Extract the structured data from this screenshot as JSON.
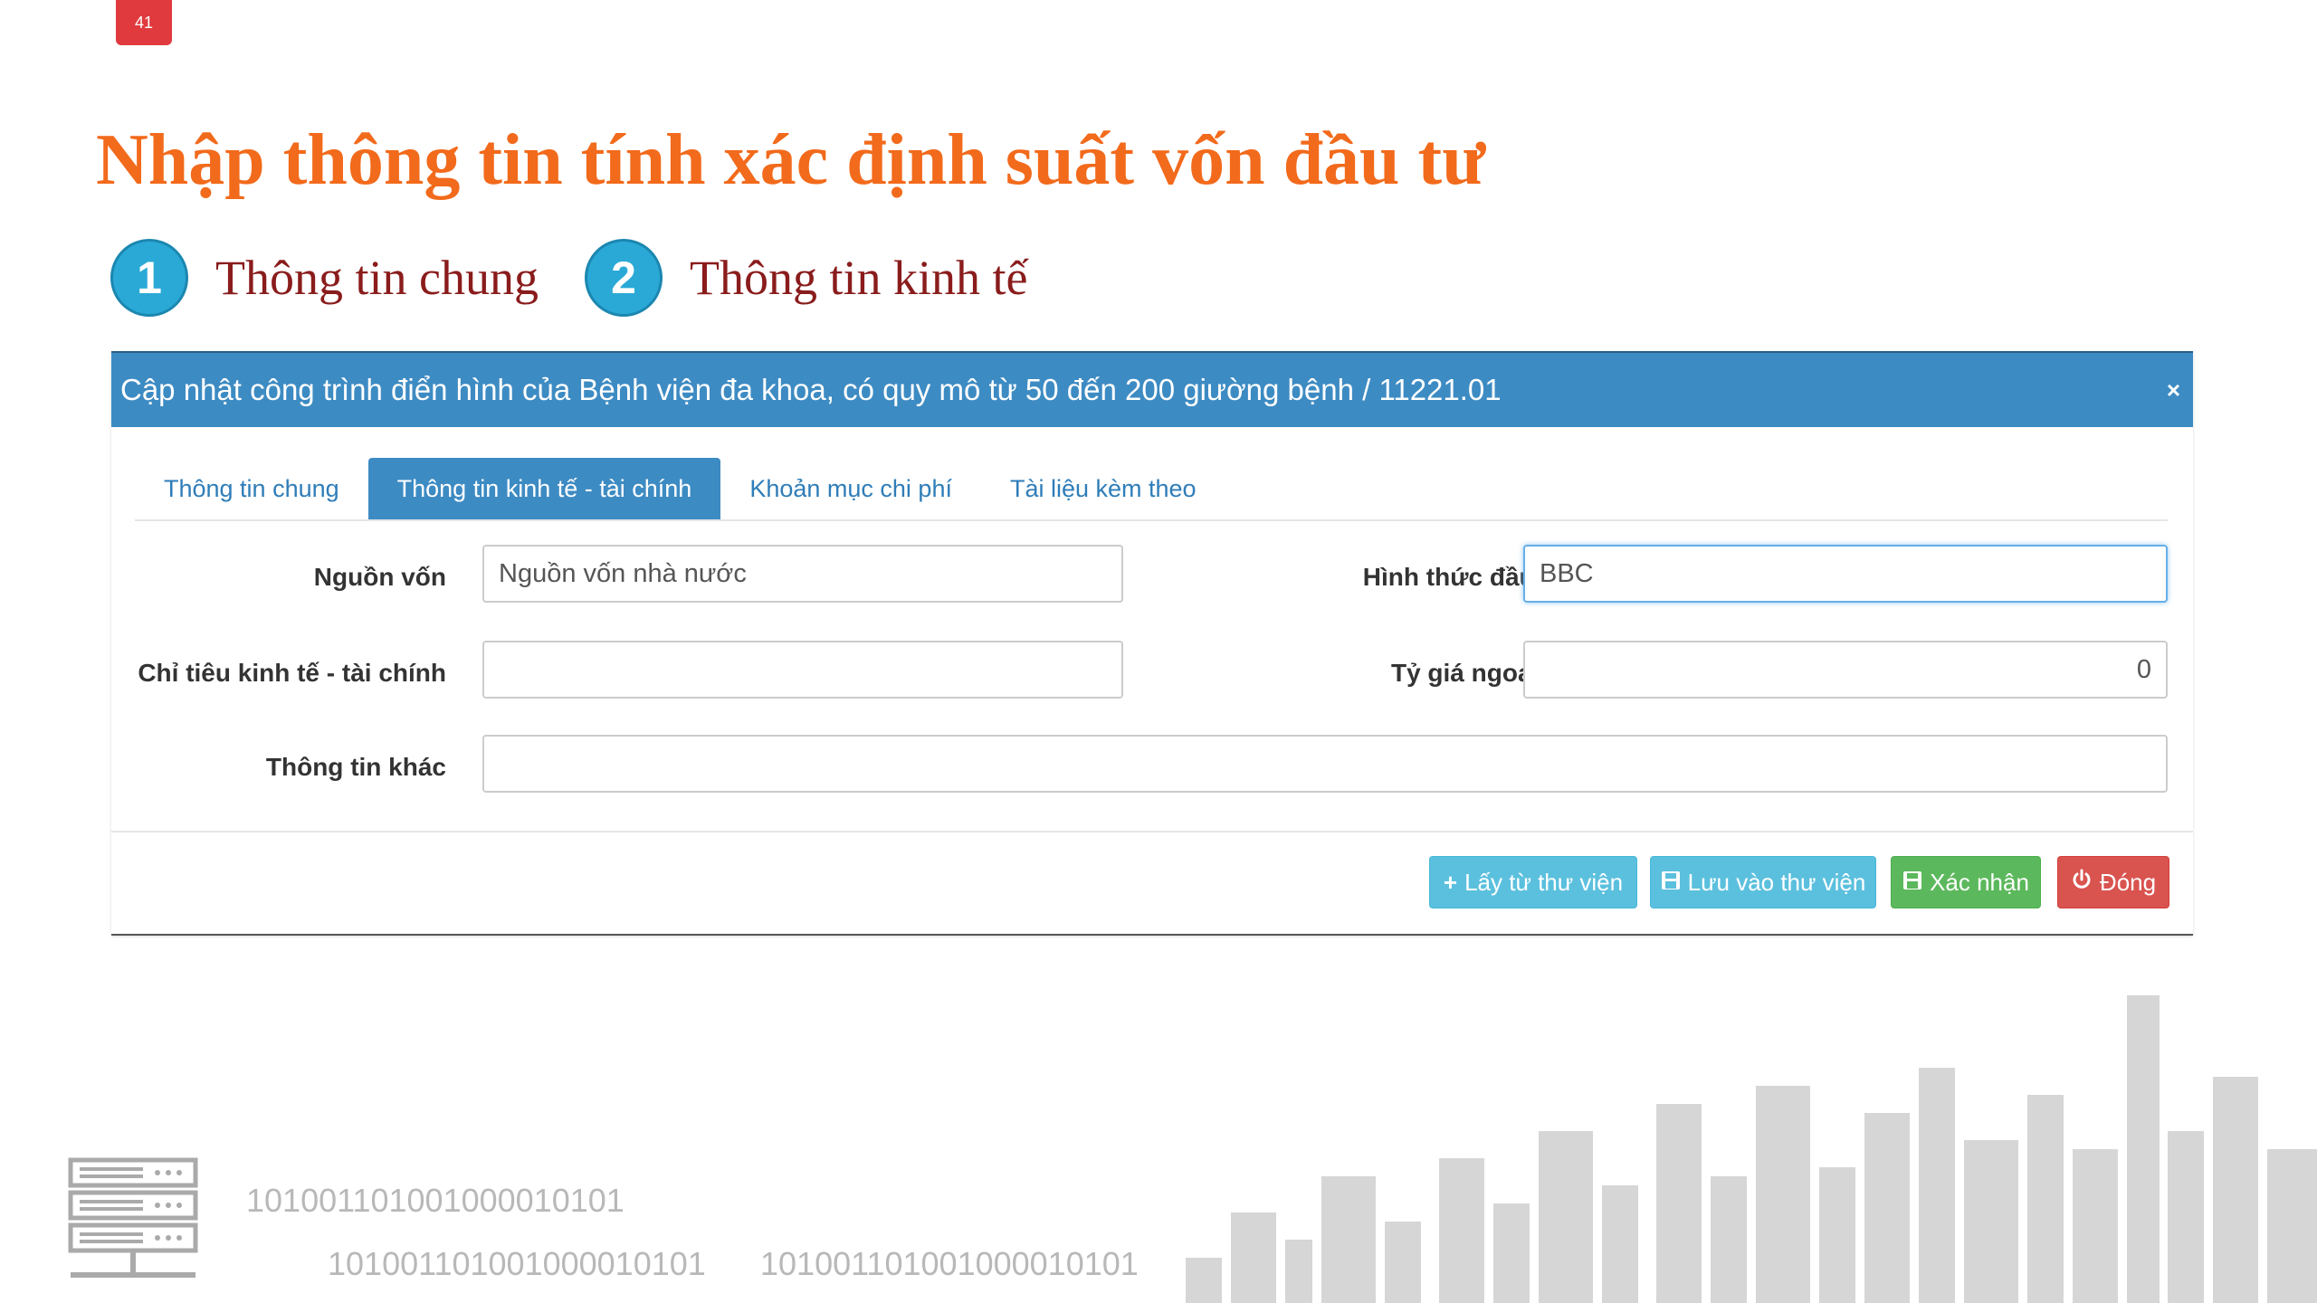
{
  "slide_number": "41",
  "title": "Nhập thông tin tính xác định suất vốn đầu tư",
  "steps": [
    {
      "number": "1",
      "label": "Thông tin chung"
    },
    {
      "number": "2",
      "label": "Thông tin kinh tế"
    }
  ],
  "dialog": {
    "title": "Cập nhật công trình điển hình của Bệnh viện đa khoa, có quy mô từ 50 đến 200 giường bệnh / 11221.01",
    "close": "×",
    "tabs": [
      {
        "label": "Thông tin chung",
        "active": false
      },
      {
        "label": "Thông tin kinh tế - tài chính",
        "active": true
      },
      {
        "label": "Khoản mục chi phí",
        "active": false
      },
      {
        "label": "Tài liệu kèm theo",
        "active": false
      }
    ],
    "fields": {
      "nguon_von": {
        "label": "Nguồn vốn",
        "value": "Nguồn vốn nhà nước"
      },
      "hinh_thuc": {
        "label": "Hình thức đầu tư",
        "value": "BBC"
      },
      "chi_tieu": {
        "label": "Chỉ tiêu kinh tế - tài chính",
        "value": ""
      },
      "ty_gia": {
        "label": "Tỷ giá ngoại tệ",
        "value": "0"
      },
      "thong_tin_khac": {
        "label": "Thông tin khác",
        "value": ""
      }
    },
    "buttons": {
      "lay_tu_thu_vien": "Lấy từ thư viện",
      "luu_vao_thu_vien": "Lưu vào thư viện",
      "xac_nhan": "Xác nhận",
      "dong": "Đóng"
    }
  },
  "decor": {
    "binary_1": "10100110100100001010‍1",
    "binary_2": "101001101001000010101",
    "binary_3": "101001101001000010101"
  },
  "colors": {
    "title": "#f26a1b",
    "step_circle": "#2aa9d6",
    "step_label": "#8a1c1c",
    "header": "#3d8bc3",
    "btn_info": "#5bc0de",
    "btn_success": "#5cb85c",
    "btn_danger": "#d9534f"
  }
}
